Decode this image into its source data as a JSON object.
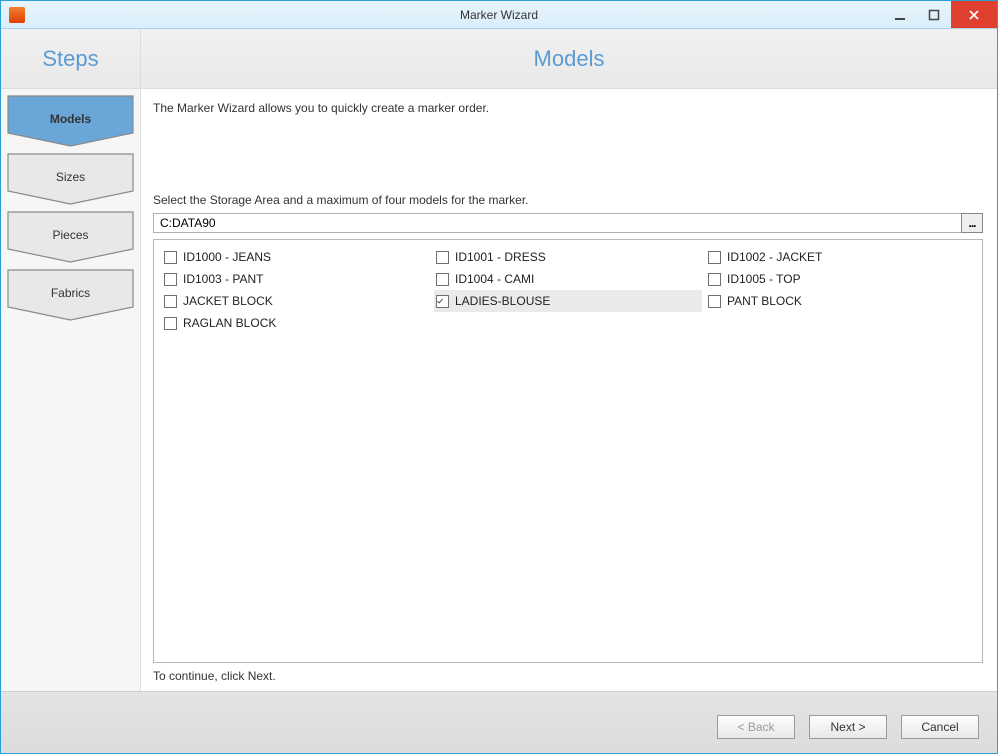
{
  "window": {
    "title": "Marker Wizard"
  },
  "header": {
    "steps_label": "Steps",
    "page_label": "Models"
  },
  "sidebar": {
    "steps": [
      {
        "label": "Models",
        "active": true
      },
      {
        "label": "Sizes",
        "active": false
      },
      {
        "label": "Pieces",
        "active": false
      },
      {
        "label": "Fabrics",
        "active": false
      }
    ]
  },
  "main": {
    "intro": "The Marker Wizard allows you to quickly create a  marker order.",
    "prompt": "Select the Storage Area and a maximum of four models for the marker.",
    "storage_path": "C:DATA90",
    "browse_label": "...",
    "continue_hint": "To continue, click Next."
  },
  "models": [
    {
      "label": "ID1000 - JEANS",
      "checked": false
    },
    {
      "label": "ID1001 - DRESS",
      "checked": false
    },
    {
      "label": "ID1002 - JACKET",
      "checked": false
    },
    {
      "label": "ID1003 - PANT",
      "checked": false
    },
    {
      "label": "ID1004 - CAMI",
      "checked": false
    },
    {
      "label": "ID1005 - TOP",
      "checked": false
    },
    {
      "label": "JACKET BLOCK",
      "checked": false
    },
    {
      "label": "LADIES-BLOUSE",
      "checked": true
    },
    {
      "label": "PANT BLOCK",
      "checked": false
    },
    {
      "label": "RAGLAN BLOCK",
      "checked": false
    }
  ],
  "footer": {
    "back_label": "< Back",
    "next_label": "Next >",
    "cancel_label": "Cancel"
  },
  "colors": {
    "accent": "#5a9bd4",
    "step_active_fill": "#6aa7d8",
    "step_inactive_fill": "#e8e8e8",
    "step_stroke": "#8a8a8a"
  }
}
